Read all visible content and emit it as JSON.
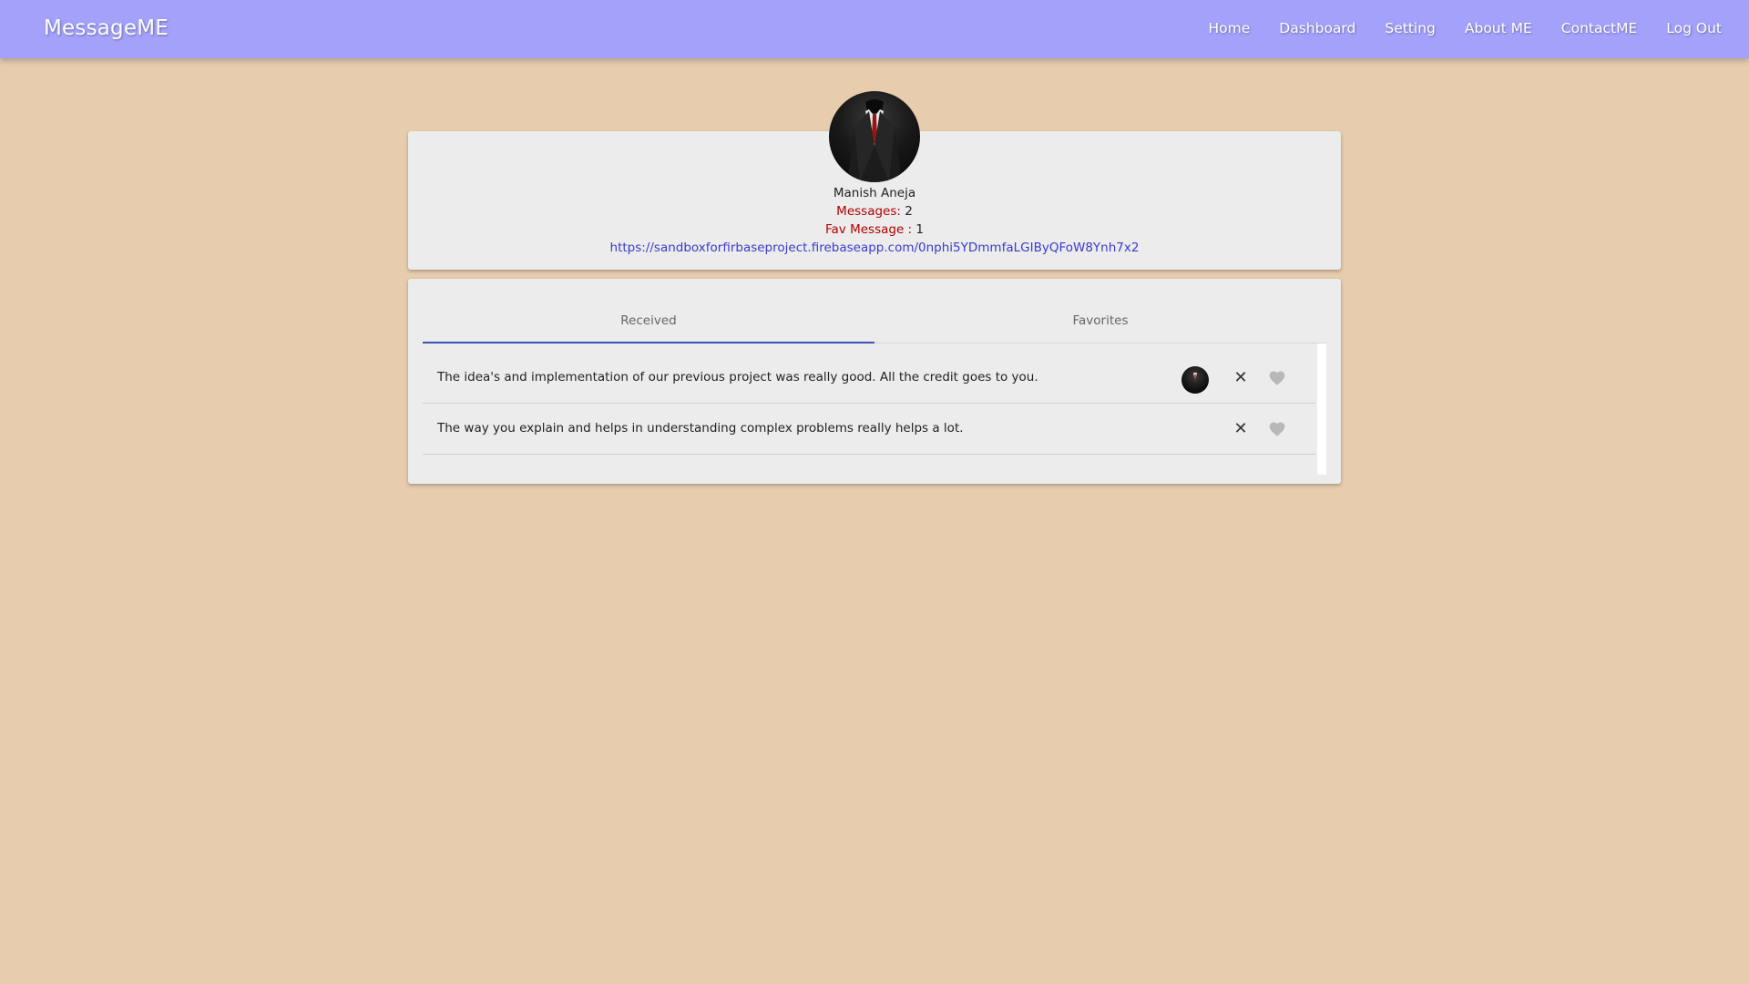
{
  "navbar": {
    "brand": "MessageME",
    "links": [
      {
        "label": "Home"
      },
      {
        "label": "Dashboard"
      },
      {
        "label": "Setting"
      },
      {
        "label": "About ME"
      },
      {
        "label": "ContactME"
      },
      {
        "label": "Log Out"
      }
    ]
  },
  "profile": {
    "name": "Manish Aneja",
    "messages_label": "Messages:",
    "messages_count": "2",
    "fav_label": "Fav Message :",
    "fav_count": "1",
    "link": "https://sandboxforfirbaseproject.firebaseapp.com/0nphi5YDmmfaLGIByQFoW8Ynh7x2"
  },
  "tabs": [
    {
      "label": "Received",
      "active": true
    },
    {
      "label": "Favorites",
      "active": false
    }
  ],
  "messages": [
    {
      "text": "The idea's and implementation of our previous project was really good. All the credit goes to you.",
      "has_avatar": true,
      "favorited": false
    },
    {
      "text": "The way you explain and helps in understanding complex problems really helps a lot.",
      "has_avatar": false,
      "favorited": false
    }
  ],
  "icons": {
    "close": "close-icon",
    "heart": "heart-icon"
  },
  "colors": {
    "navbar_bg": "#a4a1fb",
    "page_bg": "#e8ccae",
    "card_bg": "#ececec",
    "accent_red": "#b00000",
    "link_blue": "#3a3acf",
    "tab_indicator": "#3f51b5",
    "heart_gray": "#b8b8b8"
  }
}
